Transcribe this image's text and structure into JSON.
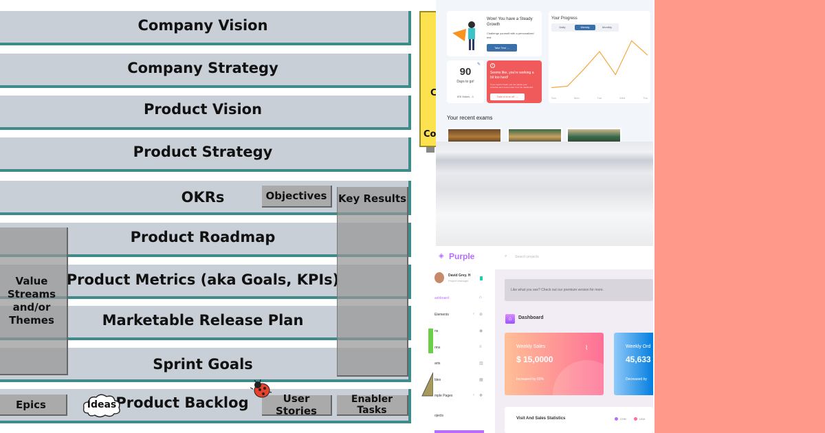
{
  "diagram": {
    "layers": [
      "Company Vision",
      "Company Strategy",
      "Product Vision",
      "Product Strategy",
      "OKRs",
      "Product Roadmap",
      "Product Metrics (aka Goals, KPIs)",
      "Marketable Release Plan",
      "Sprint Goals",
      "Product Backlog"
    ],
    "objectives": "Objectives",
    "key_results": "Key Results",
    "value_streams": "Value Streams and/or Themes",
    "epics": "Epics",
    "ideas": "Ideas",
    "user_stories": "User Stories",
    "enabler_tasks": "Enabler Tasks",
    "yellow_card_text": [
      "C",
      "Co"
    ]
  },
  "dashboard_top": {
    "growth_title": "Wow! You have a Steady Growth",
    "growth_text": "Challenge yourself with a personalized test",
    "take_test": "Take Test →",
    "progress_title": "Your Progress",
    "tabs": [
      "Daily",
      "Weekly",
      "Monthly"
    ],
    "days_number": "90",
    "days_label": "Days to go!",
    "days_sub": "IEE Mains - 1",
    "alert_title": "Seems like, you're working a bit too hard!",
    "alert_text": "If you need a break, you can pause your schedule and resume later from the dashboard.",
    "alert_button": "Take a time off →",
    "x_ticks": [
      "Sun",
      "Mon",
      "Tue",
      "Wed",
      "Thu"
    ],
    "progress_values": [
      10,
      12,
      35,
      60,
      28,
      75,
      55
    ],
    "recent_exams": "Your recent exams"
  },
  "dashboard_bottom": {
    "brand": "Purple",
    "search_placeholder": "Search projects",
    "user_name": "David Grey. H",
    "user_role": "Project Manager",
    "nav": [
      "ashboard",
      "Elements",
      "ns",
      "rms",
      "arts",
      "bles",
      "mple Pages",
      "ojects"
    ],
    "promo": "Like what you see? Check out our premium version for more.",
    "page_title": "Dashboard",
    "weekly_sales_label": "Weekly Sales",
    "weekly_sales_value": "$ 15,0000",
    "weekly_sales_change": "Increased by 60%",
    "weekly_orders_label": "Weekly Ord",
    "weekly_orders_value": "45,633",
    "weekly_orders_change": "Decreased by",
    "stats_title": "Visit And Sales Statistics",
    "legend": [
      "CHN",
      "USA"
    ],
    "colors": {
      "purple": "#b66dff",
      "salmon": "#ff9a8a",
      "orange": "#f7a63a",
      "blue": "#3b6fa8",
      "red": "#f05a5a"
    }
  }
}
